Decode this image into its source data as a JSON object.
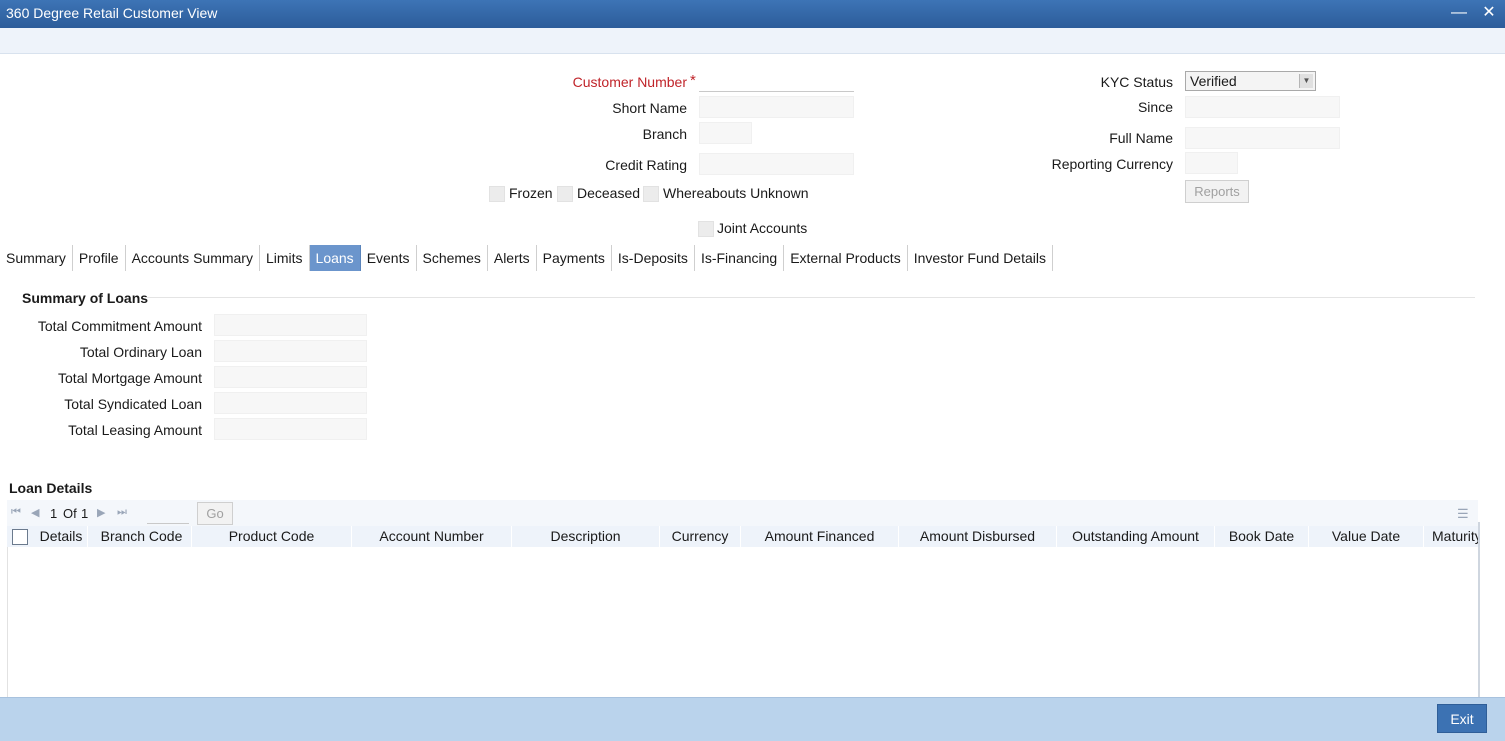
{
  "window": {
    "title": "360 Degree Retail Customer View",
    "minimize_icon": "minimize-icon",
    "close_icon": "close-icon"
  },
  "header_form": {
    "customer_number_label": "Customer Number",
    "required_mark": "*",
    "short_name_label": "Short Name",
    "branch_label": "Branch",
    "credit_rating_label": "Credit Rating",
    "kyc_status_label": "KYC Status",
    "kyc_status_value": "Verified",
    "since_label": "Since",
    "full_name_label": "Full Name",
    "reporting_currency_label": "Reporting Currency",
    "reports_button": "Reports",
    "frozen_label": "Frozen",
    "deceased_label": "Deceased",
    "whereabouts_label": "Whereabouts Unknown",
    "joint_accounts_label": "Joint Accounts"
  },
  "tabs": [
    {
      "label": "Summary"
    },
    {
      "label": "Profile"
    },
    {
      "label": "Accounts Summary"
    },
    {
      "label": "Limits"
    },
    {
      "label": "Loans"
    },
    {
      "label": "Events"
    },
    {
      "label": "Schemes"
    },
    {
      "label": "Alerts"
    },
    {
      "label": "Payments"
    },
    {
      "label": "Is-Deposits"
    },
    {
      "label": "Is-Financing"
    },
    {
      "label": "External Products"
    },
    {
      "label": "Investor Fund Details"
    }
  ],
  "active_tab": "Loans",
  "summary_of_loans": {
    "title": "Summary of Loans",
    "fields": [
      {
        "label": "Total Commitment Amount",
        "value": ""
      },
      {
        "label": "Total Ordinary Loan",
        "value": ""
      },
      {
        "label": "Total Mortgage Amount",
        "value": ""
      },
      {
        "label": "Total Syndicated Loan",
        "value": ""
      },
      {
        "label": "Total Leasing Amount",
        "value": ""
      }
    ]
  },
  "loan_details": {
    "title": "Loan Details",
    "pagination": {
      "current": "1",
      "of_label": "Of",
      "total": "1",
      "go_button": "Go"
    },
    "columns": [
      "Details",
      "Branch Code",
      "Product Code",
      "Account Number",
      "Description",
      "Currency",
      "Amount Financed",
      "Amount Disbursed",
      "Outstanding Amount",
      "Book Date",
      "Value Date",
      "Maturity"
    ],
    "rows": []
  },
  "footer": {
    "exit_button": "Exit"
  },
  "colors": {
    "titlebar": "#2c5c9a",
    "active_tab": "#6b95cc",
    "footer": "#bad3ec",
    "required": "#c0242a"
  }
}
